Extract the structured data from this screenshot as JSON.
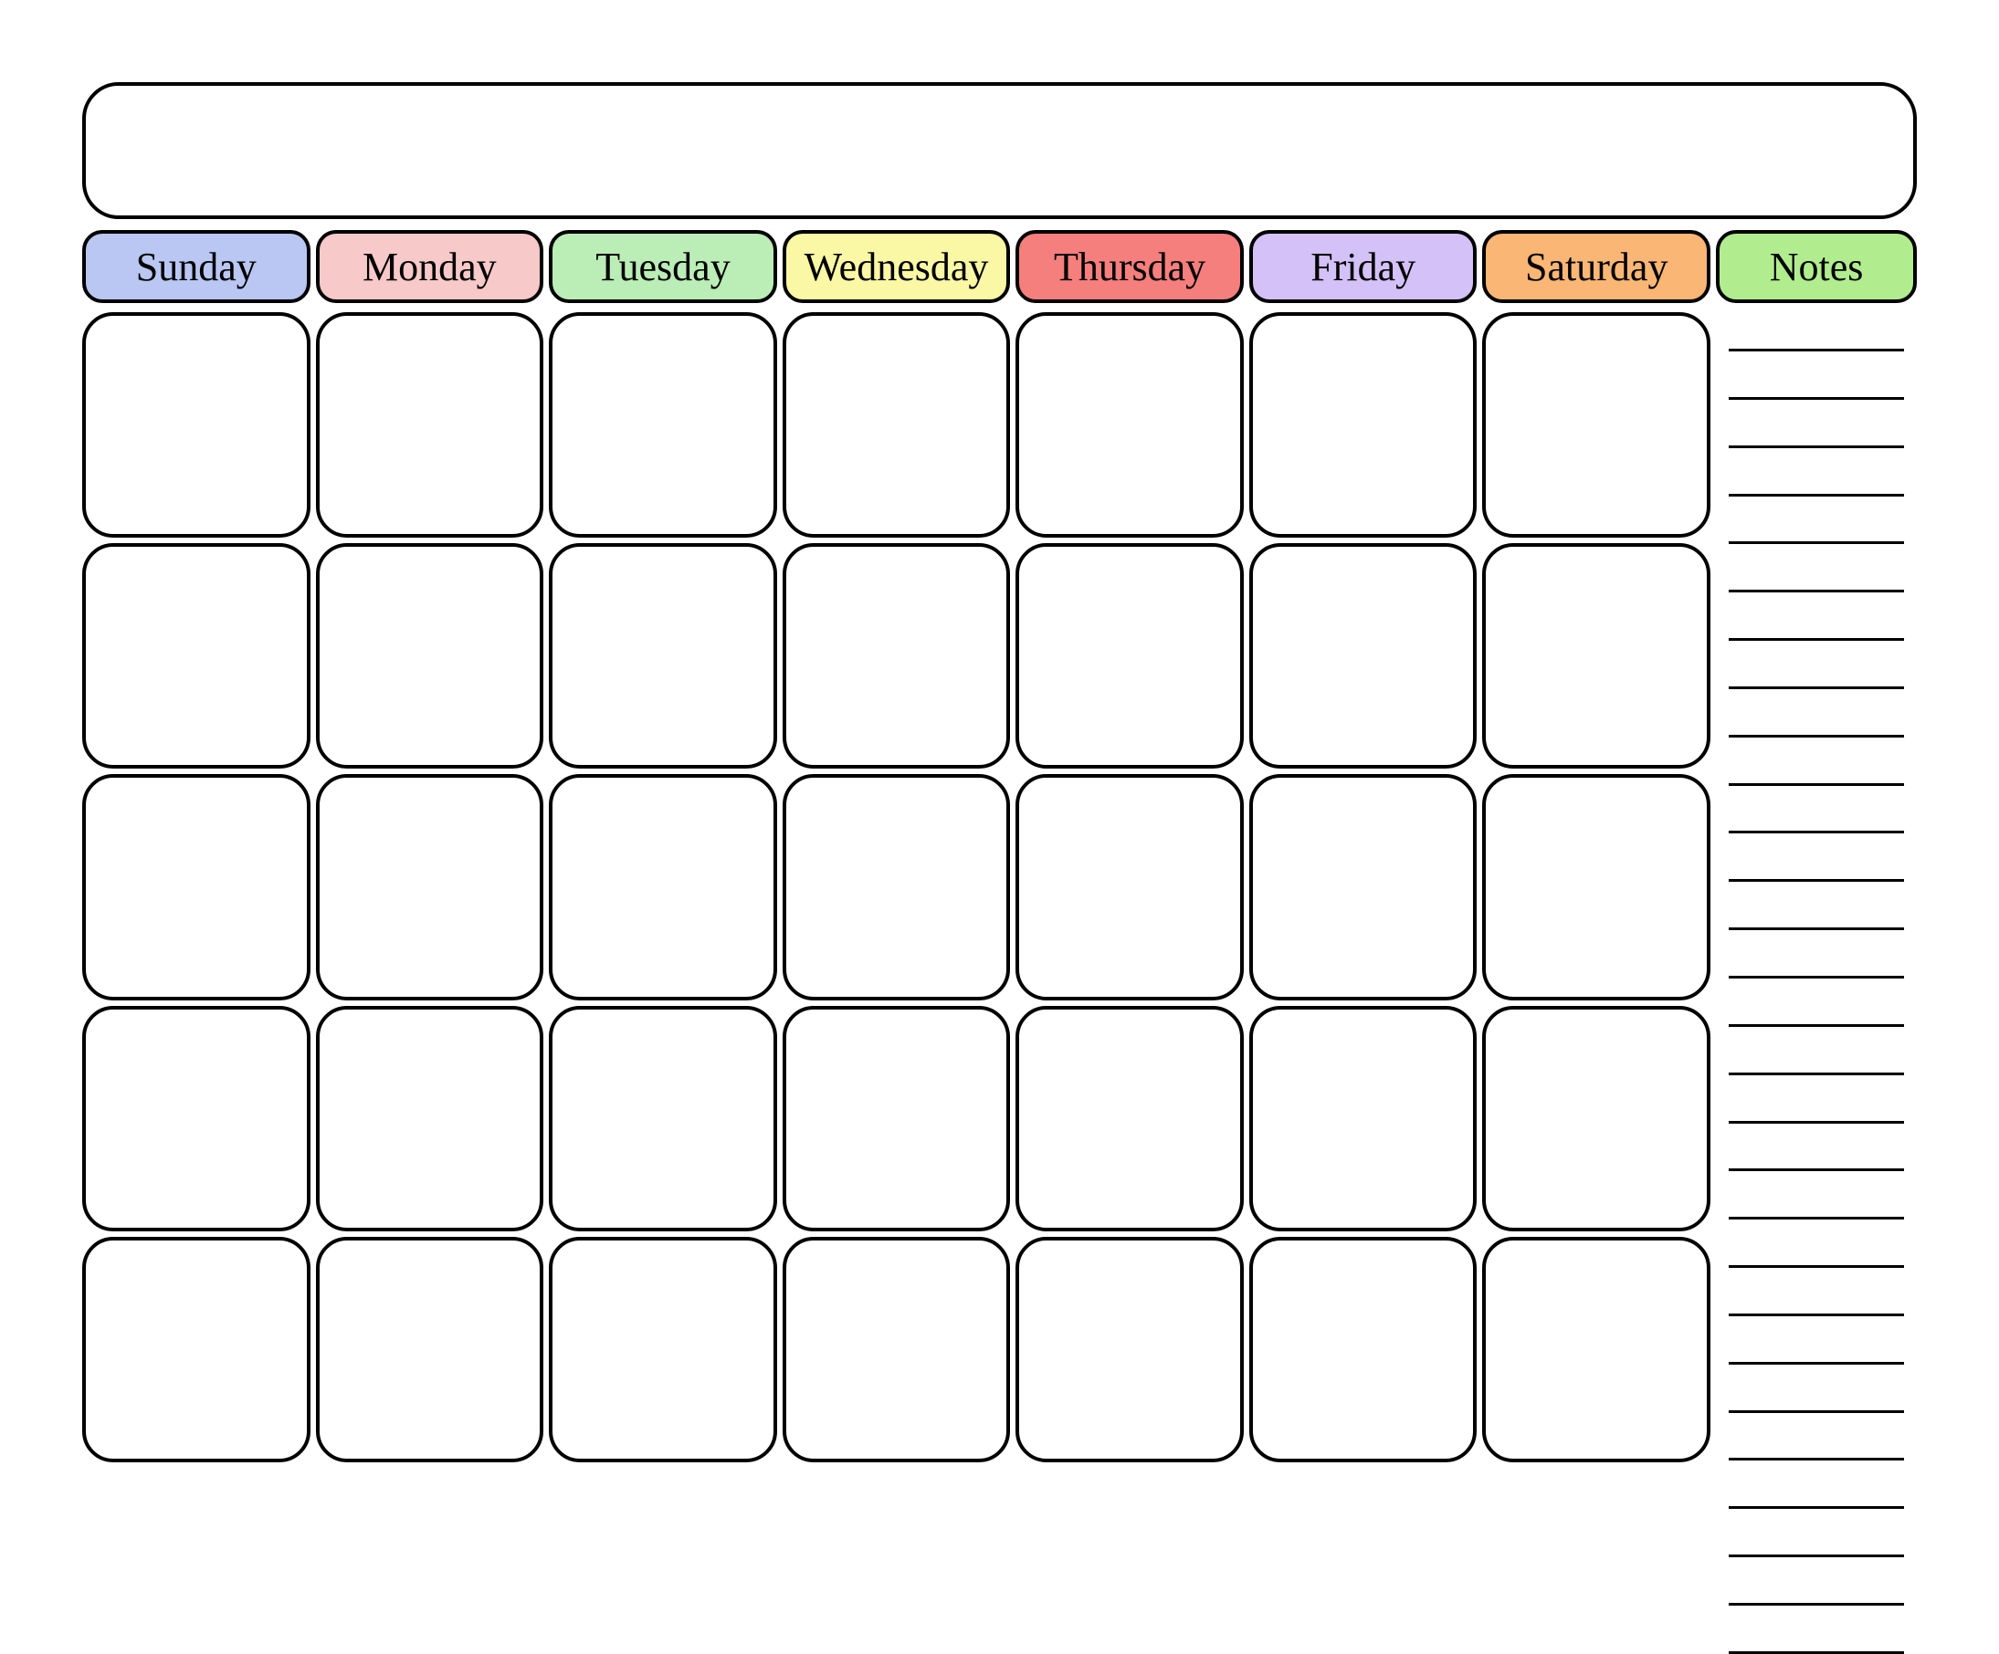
{
  "days": [
    "Sunday",
    "Monday",
    "Tuesday",
    "Wednesday",
    "Thursday",
    "Friday",
    "Saturday"
  ],
  "notes_label": "Notes",
  "day_colors": [
    "#b9c7f2",
    "#f8c9c9",
    "#bbedb6",
    "#faf7a5",
    "#f57f7d",
    "#d4c1f7",
    "#f9b675"
  ],
  "notes_color": "#b1ed8e",
  "weeks": 5,
  "note_lines": 28
}
